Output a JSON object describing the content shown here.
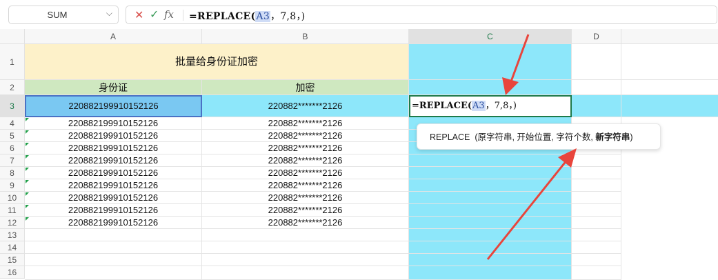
{
  "formula_bar": {
    "name_box": "SUM",
    "fn_name": "REPLACE",
    "open_paren": "(",
    "ref": "A3",
    "rest": "，7,8，)",
    "prefix": "=",
    "cancel_icon": "✕",
    "confirm_icon": "✓",
    "insert_fn_icon": "fx"
  },
  "columns": [
    "A",
    "B",
    "C",
    "D"
  ],
  "rows": [
    "1",
    "2",
    "3",
    "4",
    "5",
    "6",
    "7",
    "8",
    "9",
    "10",
    "11",
    "12",
    "13",
    "14",
    "15",
    "16"
  ],
  "title": "批量给身份证加密",
  "headers": {
    "a": "身份证",
    "b": "加密"
  },
  "data_rows": [
    {
      "a": "220882199910152126",
      "b": "220882*******2126"
    },
    {
      "a": "220882199910152126",
      "b": "220882*******2126"
    },
    {
      "a": "220882199910152126",
      "b": "220882*******2126"
    },
    {
      "a": "220882199910152126",
      "b": "220882*******2126"
    },
    {
      "a": "220882199910152126",
      "b": "220882*******2126"
    },
    {
      "a": "220882199910152126",
      "b": "220882*******2126"
    },
    {
      "a": "220882199910152126",
      "b": "220882*******2126"
    },
    {
      "a": "220882199910152126",
      "b": "220882*******2126"
    },
    {
      "a": "220882199910152126",
      "b": "220882*******2126"
    },
    {
      "a": "220882199910152126",
      "b": "220882*******2126"
    }
  ],
  "tooltip": {
    "fn": "REPLACE",
    "args": "(原字符串, 开始位置, 字符个数, ",
    "current_arg": "新字符串",
    "close": ")"
  },
  "colors": {
    "accent_green": "#1e7a4a",
    "highlight_cyan": "#8de7fa",
    "arrow_red": "#e8453c"
  }
}
